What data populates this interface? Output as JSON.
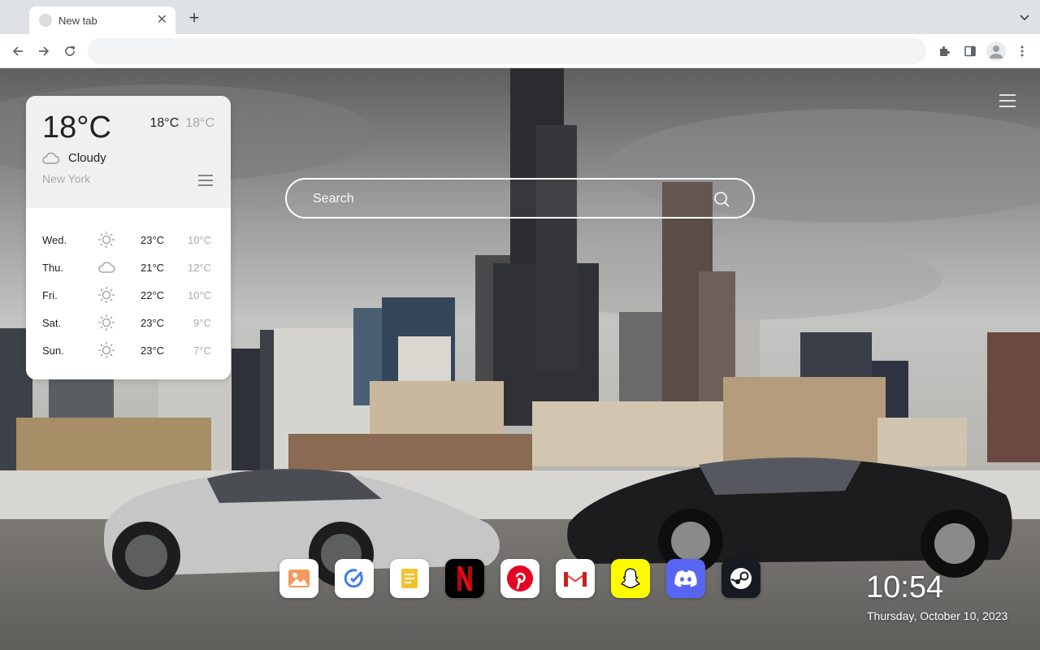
{
  "browser": {
    "tab_title": "New tab",
    "address_value": "",
    "address_placeholder": ""
  },
  "weather": {
    "current_temp": "18°C",
    "high": "18°C",
    "low": "18°C",
    "condition": "Cloudy",
    "city": "New York",
    "forecast": [
      {
        "day": "Wed.",
        "icon": "sun-icon",
        "high": "23°C",
        "low": "10°C"
      },
      {
        "day": "Thu.",
        "icon": "cloud-icon",
        "high": "21°C",
        "low": "12°C"
      },
      {
        "day": "Fri.",
        "icon": "sun-icon",
        "high": "22°C",
        "low": "10°C"
      },
      {
        "day": "Sat.",
        "icon": "sun-icon",
        "high": "23°C",
        "low": "9°C"
      },
      {
        "day": "Sun.",
        "icon": "sun-icon",
        "high": "23°C",
        "low": "7°C"
      }
    ]
  },
  "search": {
    "placeholder": "Search"
  },
  "dock": {
    "apps": [
      {
        "name": "photos-icon",
        "color": "#ffffff"
      },
      {
        "name": "tasks-icon",
        "color": "#ffffff"
      },
      {
        "name": "notes-icon",
        "color": "#ffffff"
      },
      {
        "name": "netflix-icon",
        "color": "#000000"
      },
      {
        "name": "pinterest-icon",
        "color": "#ffffff"
      },
      {
        "name": "gmail-icon",
        "color": "#ffffff"
      },
      {
        "name": "snapchat-icon",
        "color": "#fffc00"
      },
      {
        "name": "discord-icon",
        "color": "#5865f2"
      },
      {
        "name": "steam-icon",
        "color": "#171a21"
      }
    ]
  },
  "clock": {
    "time": "10:54",
    "date": "Thursday, October 10, 2023"
  }
}
